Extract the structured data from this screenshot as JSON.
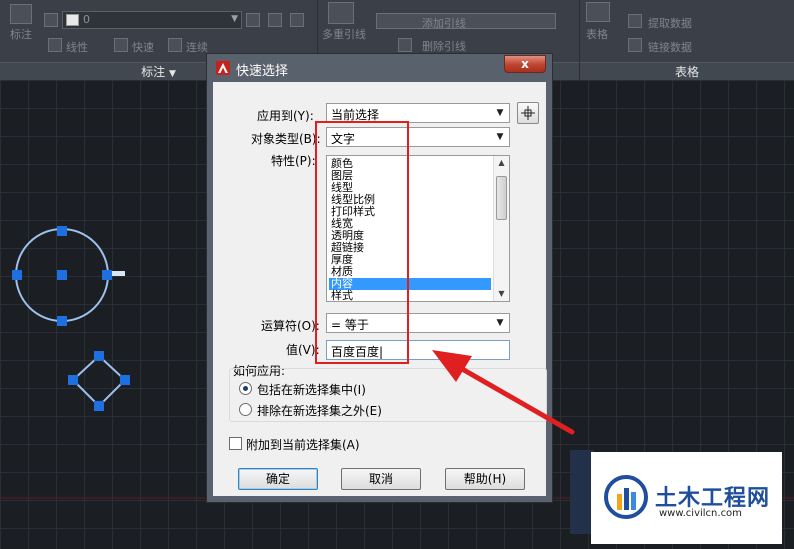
{
  "ribbon": {
    "panel_annotation": {
      "title": "标注",
      "dimension_style_value": "0",
      "linear_label": "线性",
      "quick_label": "快速",
      "continue_label": "连续"
    },
    "panel_leaders": {
      "multileader_label": "多重引线",
      "add_leader_label": "添加引线",
      "remove_leader_label": "删除引线"
    },
    "panel_table": {
      "title": "表格",
      "table_label": "表格",
      "extract_data_label": "提取数据",
      "link_data_label": "链接数据"
    }
  },
  "dialog": {
    "title": "快速选择",
    "close_symbol": "x",
    "apply_to_label": "应用到(Y):",
    "apply_to_value": "当前选择",
    "object_type_label": "对象类型(B):",
    "object_type_value": "文字",
    "properties_label": "特性(P):",
    "properties": [
      "颜色",
      "图层",
      "线型",
      "线型比例",
      "打印样式",
      "线宽",
      "透明度",
      "超链接",
      "厚度",
      "材质",
      "内容",
      "样式"
    ],
    "selected_property": "内容",
    "operator_label": "运算符(O):",
    "operator_value": "= 等于",
    "value_label": "值(V):",
    "value": "百度百度|",
    "how_to_apply_label": "如何应用:",
    "include_label": "包括在新选择集中(I)",
    "exclude_label": "排除在新选择集之外(E)",
    "include_selected": true,
    "append_label": "附加到当前选择集(A)",
    "append_checked": false,
    "ok_label": "确定",
    "cancel_label": "取消",
    "help_label": "帮助(H)"
  },
  "watermark": {
    "title": "土木工程网",
    "url": "www.civilcn.com"
  },
  "colors": {
    "selection_blue": "#3399ff",
    "annotation_red": "#e02020",
    "grip_blue": "#1e6fe0",
    "watermark_blue": "#1f4e9c"
  }
}
